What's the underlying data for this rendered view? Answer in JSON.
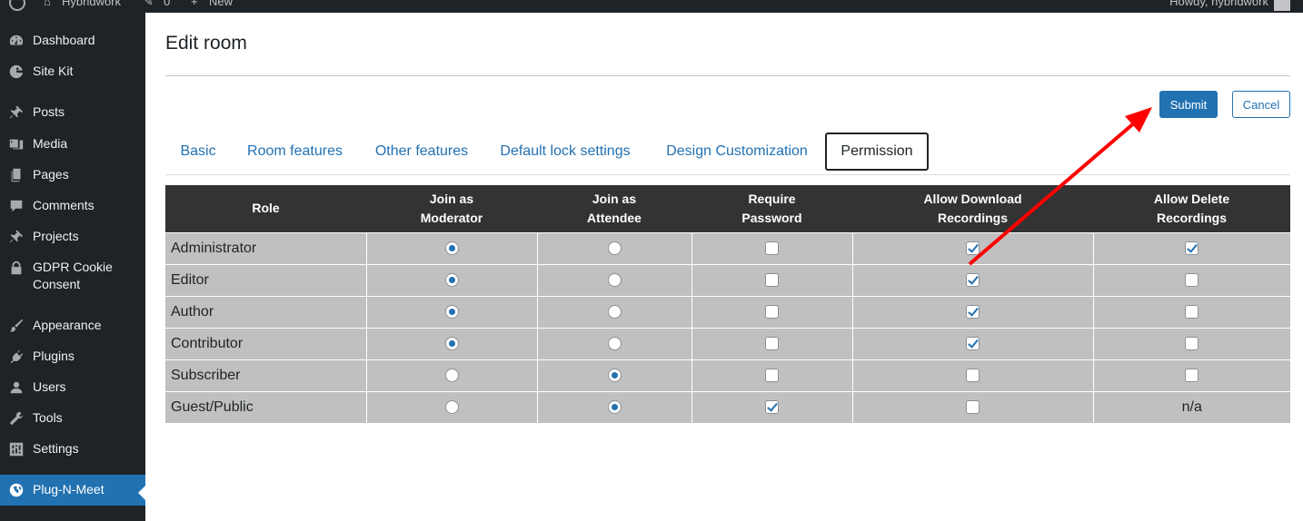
{
  "admin_bar": {
    "site_name": "Hybridwork",
    "comments_count": "0",
    "new_label": "New",
    "greeting": "Howdy, hybridwork"
  },
  "sidebar": {
    "items": [
      {
        "label": "Dashboard",
        "icon": "dashboard-icon"
      },
      {
        "label": "Site Kit",
        "icon": "google-g-icon"
      },
      {
        "label": "Posts",
        "icon": "pin-icon"
      },
      {
        "label": "Media",
        "icon": "media-icon"
      },
      {
        "label": "Pages",
        "icon": "pages-icon"
      },
      {
        "label": "Comments",
        "icon": "comment-icon"
      },
      {
        "label": "Projects",
        "icon": "pin-icon"
      },
      {
        "label": "GDPR Cookie\nConsent",
        "icon": "lock-icon"
      },
      {
        "label": "Appearance",
        "icon": "brush-icon"
      },
      {
        "label": "Plugins",
        "icon": "plugin-icon"
      },
      {
        "label": "Users",
        "icon": "user-icon"
      },
      {
        "label": "Tools",
        "icon": "wrench-icon"
      },
      {
        "label": "Settings",
        "icon": "settings-icon"
      },
      {
        "label": "Plug-N-Meet",
        "icon": "globe-icon",
        "active": true
      }
    ]
  },
  "page": {
    "title": "Edit room"
  },
  "actions": {
    "submit_label": "Submit",
    "cancel_label": "Cancel"
  },
  "tabs": [
    {
      "label": "Basic"
    },
    {
      "label": "Room features"
    },
    {
      "label": "Other features"
    },
    {
      "label": "Default lock settings"
    },
    {
      "label": "Design Customization"
    },
    {
      "label": "Permission",
      "active": true
    }
  ],
  "permissions": {
    "headers": [
      "Role",
      "Join as\nModerator",
      "Join as\nAttendee",
      "Require\nPassword",
      "Allow Download\nRecordings",
      "Allow Delete\nRecordings"
    ],
    "rows": [
      {
        "role": "Administrator",
        "join_as": "moderator",
        "require_password": false,
        "allow_download": true,
        "allow_delete": true
      },
      {
        "role": "Editor",
        "join_as": "moderator",
        "require_password": false,
        "allow_download": true,
        "allow_delete": false
      },
      {
        "role": "Author",
        "join_as": "moderator",
        "require_password": false,
        "allow_download": true,
        "allow_delete": false
      },
      {
        "role": "Contributor",
        "join_as": "moderator",
        "require_password": false,
        "allow_download": true,
        "allow_delete": false
      },
      {
        "role": "Subscriber",
        "join_as": "attendee",
        "require_password": false,
        "allow_download": false,
        "allow_delete": false
      },
      {
        "role": "Guest/Public",
        "join_as": "attendee",
        "require_password": true,
        "allow_download": false,
        "allow_delete": "n/a"
      }
    ]
  },
  "colors": {
    "accent": "#2271b1",
    "sidebar_bg": "#1d2327",
    "table_header_bg": "#333333",
    "table_cell_bg": "#c0c0c0",
    "annotation_arrow": "#ff0000"
  }
}
